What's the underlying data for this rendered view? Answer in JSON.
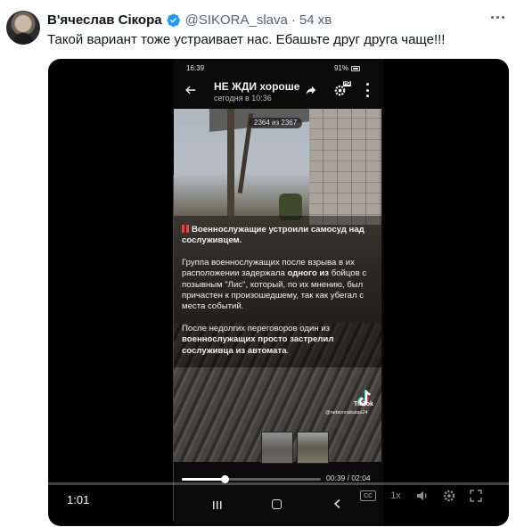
{
  "tweet": {
    "author_name": "В'ячеслав Сікора",
    "handle": "@SIKORA_slava",
    "separator": "·",
    "time": "54 хв",
    "text": "Такой вариант тоже устраивает нас. Ебашьте друг друга чаще!!!"
  },
  "phone": {
    "status_time": "16:39",
    "battery": "91%",
    "channel_title": "НЕ ЖДИ хороше",
    "channel_sub": "сегодня в 10:36",
    "hd_badge": "HD",
    "counter": "2364 из 2367",
    "caption": {
      "title": "Военнослужащие устроили самосуд над сослуживцем.",
      "p1_before": "Группа военнослужащих после взрыва в их расположении задержала ",
      "p1_bold": "одного из",
      "p1_after": " бойцов с позывным \"Лис\", который, по их мнению, был причастен к произошедшему, так как убегал с места событий.",
      "p2_before": "После недолгих переговоров один из ",
      "p2_bold": "военнослужащих просто застрелил сослуживца из автомата",
      "p2_after": "."
    },
    "tiktok_label": "TikTok",
    "tiktok_user": "@netavoraikatas24"
  },
  "player": {
    "current_time": "00:39",
    "duration": "02:04",
    "progress": 0.31,
    "twitter_time": "1:01",
    "cc_label": "CC",
    "rate_label": "1x"
  },
  "colors": {
    "verified": "#1d9bf0",
    "text": "#0f1419",
    "muted": "#536471",
    "media_bg": "#000000"
  },
  "icons": [
    "verified-icon",
    "more-icon",
    "back-arrow-icon",
    "share-icon",
    "settings-icon",
    "kebab-icon",
    "tiktok-icon",
    "volume-icon",
    "settings-gear-icon",
    "fullscreen-icon"
  ]
}
